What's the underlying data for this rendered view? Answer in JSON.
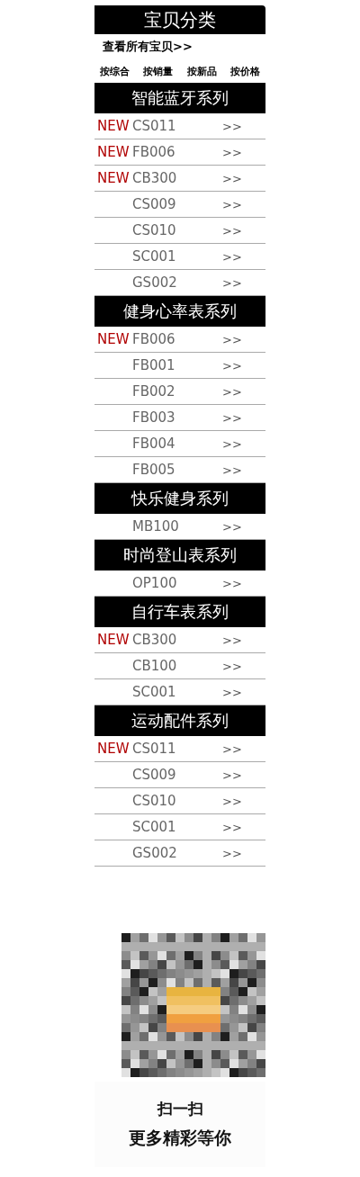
{
  "title": "宝贝分类",
  "view_all": "查看所有宝贝>>",
  "sort_links": [
    "按综合",
    "按销量",
    "按新品",
    "按价格"
  ],
  "sections": [
    {
      "title": "智能蓝牙系列",
      "items": [
        {
          "badge": "NEW",
          "code": "CS011",
          "arrow": ">>"
        },
        {
          "badge": "NEW",
          "code": "FB006",
          "arrow": ">>"
        },
        {
          "badge": "NEW",
          "code": "CB300",
          "arrow": ">>"
        },
        {
          "code": "CS009",
          "arrow": ">>"
        },
        {
          "code": "CS010",
          "arrow": ">>"
        },
        {
          "code": "SC001",
          "arrow": ">>"
        },
        {
          "code": "GS002",
          "arrow": ">>"
        }
      ]
    },
    {
      "title": "健身心率表系列",
      "items": [
        {
          "badge": "NEW",
          "code": "FB006",
          "arrow": ">>"
        },
        {
          "code": "FB001",
          "arrow": ">>"
        },
        {
          "code": "FB002",
          "arrow": ">>"
        },
        {
          "code": "FB003",
          "arrow": ">>"
        },
        {
          "code": "FB004",
          "arrow": ">>"
        },
        {
          "code": "FB005",
          "arrow": ">>"
        }
      ]
    },
    {
      "title": "快乐健身系列",
      "items": [
        {
          "code": "MB100",
          "arrow": ">>"
        }
      ]
    },
    {
      "title": "时尚登山表系列",
      "items": [
        {
          "code": "OP100",
          "arrow": ">>"
        }
      ]
    },
    {
      "title": "自行车表系列",
      "items": [
        {
          "badge": "NEW",
          "code": "CB300",
          "arrow": ">>"
        },
        {
          "code": "CB100",
          "arrow": ">>"
        },
        {
          "code": "SC001",
          "arrow": ">>"
        }
      ]
    },
    {
      "title": "运动配件系列",
      "items": [
        {
          "badge": "NEW",
          "code": "CS011",
          "arrow": ">>"
        },
        {
          "code": "CS009",
          "arrow": ">>"
        },
        {
          "code": "CS010",
          "arrow": ">>"
        },
        {
          "code": "SC001",
          "arrow": ">>"
        },
        {
          "code": "GS002",
          "arrow": ">>"
        }
      ]
    }
  ],
  "scan": {
    "line_1": "扫一扫",
    "line_2": "更多精彩等你"
  }
}
